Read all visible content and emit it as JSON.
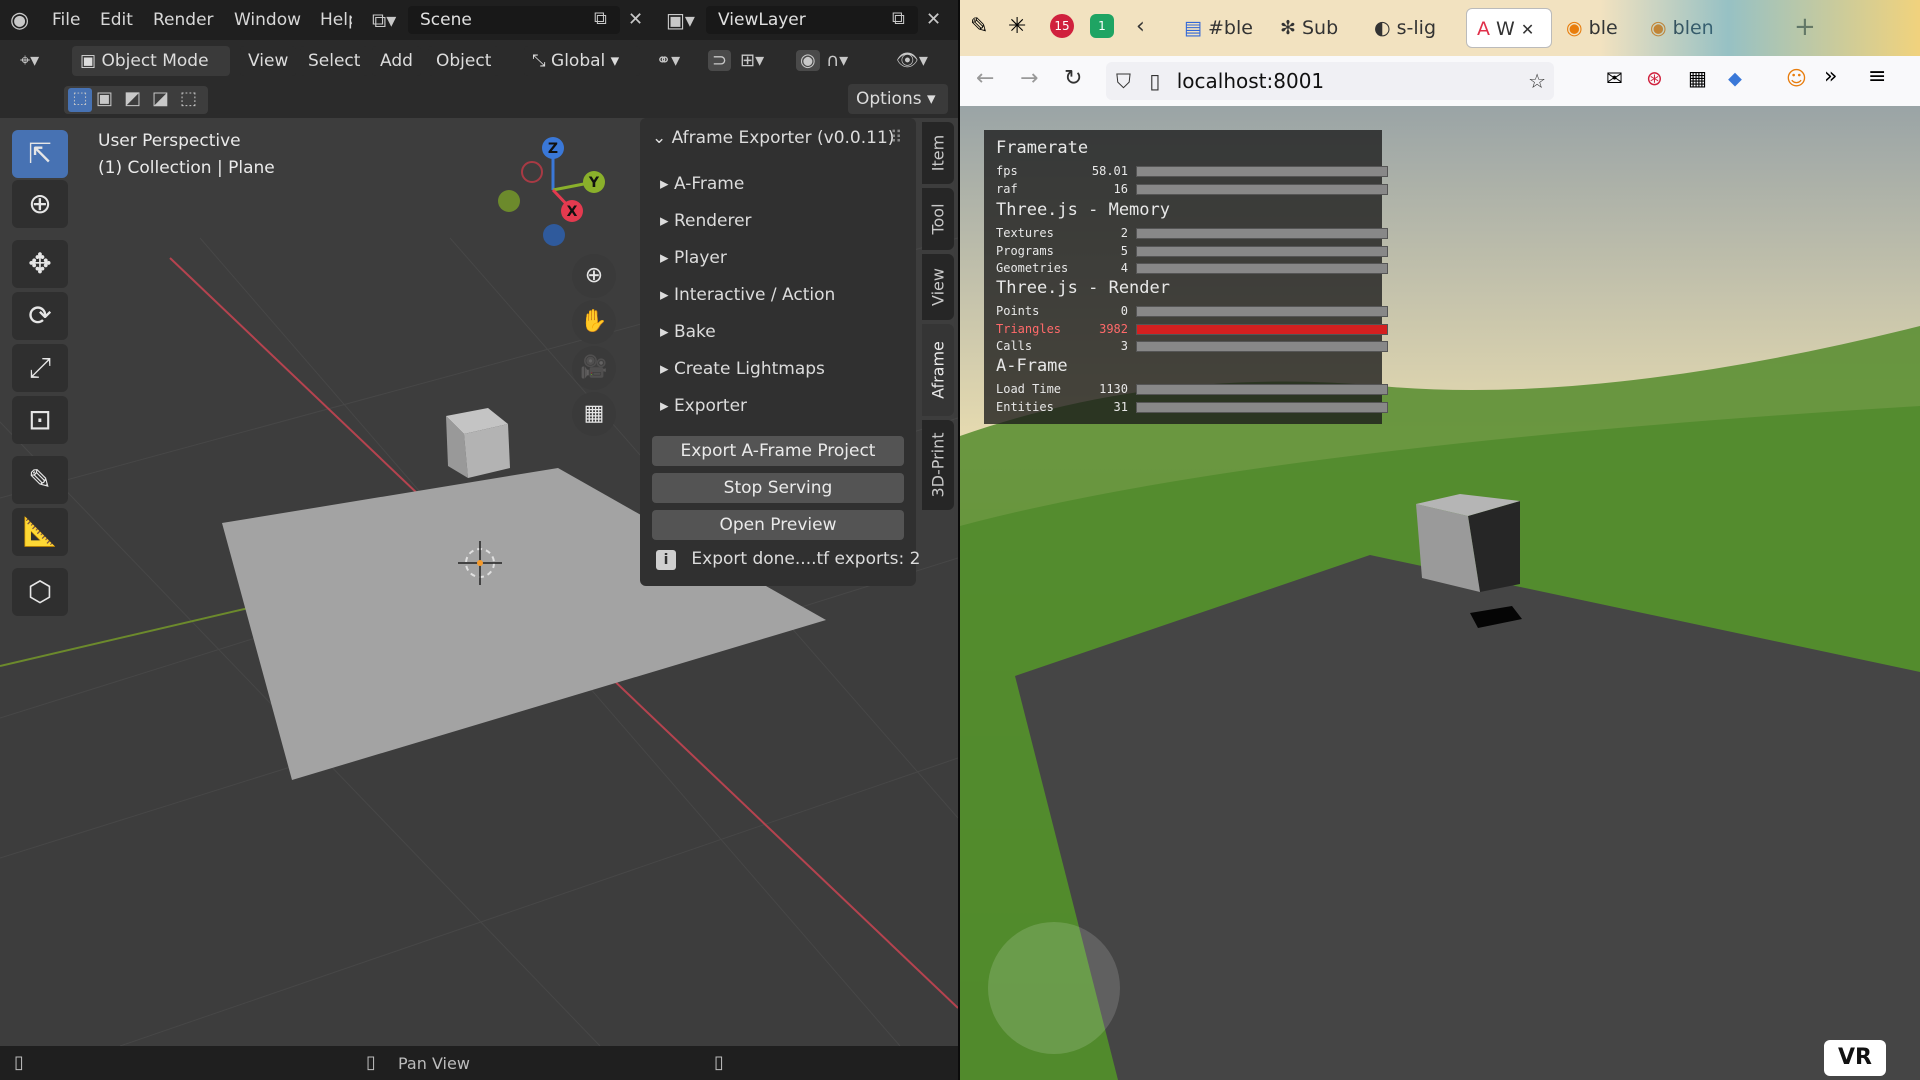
{
  "blender": {
    "menus": [
      "File",
      "Edit",
      "Render",
      "Window",
      "Help"
    ],
    "scene": "Scene",
    "view_layer": "ViewLayer",
    "mode": "Object Mode",
    "header_menus": [
      "View",
      "Select",
      "Add",
      "Object"
    ],
    "transform_orientation": "Global",
    "options": "Options",
    "viewport_title": "User Perspective",
    "viewport_context": "(1) Collection | Plane",
    "gizmo_axes": {
      "z": "Z",
      "y": "Y",
      "x": "X"
    },
    "panel_title": "Aframe Exporter (v0.0.11)",
    "panel_sections": [
      "A-Frame",
      "Renderer",
      "Player",
      "Interactive / Action",
      "Bake",
      "Create Lightmaps",
      "Exporter"
    ],
    "buttons": [
      "Export A-Frame Project",
      "Stop Serving",
      "Open Preview"
    ],
    "status_message": "Export done....tf exports: 2",
    "side_tabs": [
      "Item",
      "Tool",
      "View",
      "Aframe",
      "3D-Print"
    ],
    "statusbar_text": "Pan View",
    "colors": {
      "accent": "#4772b3",
      "x_axis": "#e43a4f",
      "y_axis": "#8ab02b",
      "z_axis": "#3a78d8"
    }
  },
  "browser": {
    "tabs": [
      "#ble",
      "Sub",
      "s-lig",
      "W",
      "ble",
      "blen"
    ],
    "url": "localhost:8001",
    "stats": {
      "framerate_title": "Framerate",
      "fps_label": "fps",
      "fps": "58.01",
      "raf_label": "raf",
      "raf": "16",
      "memory_title": "Three.js - Memory",
      "textures_label": "Textures",
      "textures": "2",
      "programs_label": "Programs",
      "programs": "5",
      "geometries_label": "Geometries",
      "geometries": "4",
      "render_title": "Three.js - Render",
      "points_label": "Points",
      "points": "0",
      "triangles_label": "Triangles",
      "triangles": "3982",
      "calls_label": "Calls",
      "calls": "3",
      "aframe_title": "A-Frame",
      "loadtime_label": "Load Time",
      "loadtime": "1130",
      "entities_label": "Entities",
      "entities": "31"
    },
    "vr_button": "VR"
  }
}
